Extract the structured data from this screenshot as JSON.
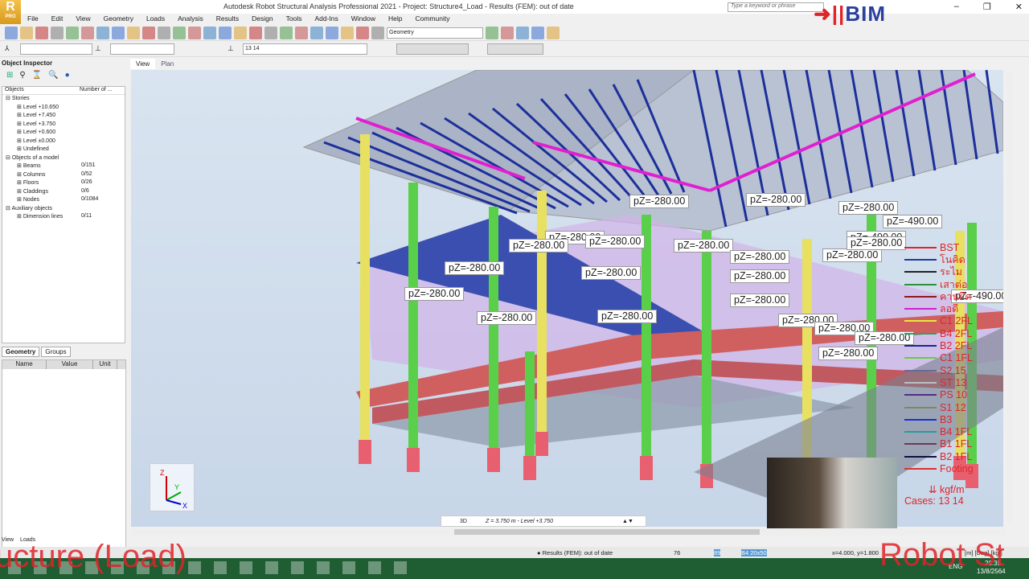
{
  "app": {
    "logo": "R",
    "logo_sub": "PRO",
    "title": "Autodesk Robot Structural Analysis Professional 2021 - Project: Structure4_Load - Results (FEM): out of date",
    "search_placeholder": "Type a keyword or phrase",
    "brand": "BIM"
  },
  "menu": [
    "File",
    "Edit",
    "View",
    "Geometry",
    "Loads",
    "Analysis",
    "Results",
    "Design",
    "Tools",
    "Add-Ins",
    "Window",
    "Help",
    "Community"
  ],
  "toolbar": {
    "layout_combo": "Geometry",
    "cases_combo": "13 14"
  },
  "inspector": {
    "title": "Object Inspector",
    "col_objects": "Objects",
    "col_number": "Number of ...",
    "rows": [
      {
        "label": "Stories",
        "count": ""
      },
      {
        "label": "Level +10.650",
        "count": ""
      },
      {
        "label": "Level +7.450",
        "count": ""
      },
      {
        "label": "Level +3.750",
        "count": ""
      },
      {
        "label": "Level +0.600",
        "count": ""
      },
      {
        "label": "Level ±0.000",
        "count": ""
      },
      {
        "label": "Undefined",
        "count": ""
      },
      {
        "label": "Objects of a model",
        "count": ""
      },
      {
        "label": "Beams",
        "count": "0/151"
      },
      {
        "label": "Columns",
        "count": "0/52"
      },
      {
        "label": "Floors",
        "count": "0/26"
      },
      {
        "label": "Claddings",
        "count": "0/6"
      },
      {
        "label": "Nodes",
        "count": "0/1084"
      },
      {
        "label": "Auxiliary objects",
        "count": ""
      },
      {
        "label": "Dimension lines",
        "count": "0/11"
      }
    ],
    "tabs": [
      "Geometry",
      "Groups"
    ],
    "prop_cols": [
      "Name",
      "Value",
      "Unit"
    ]
  },
  "view_tabs": [
    "View",
    "Plan"
  ],
  "loads": [
    "pZ=-280.00",
    "pZ=-280.00",
    "pZ=-280.00",
    "pZ=-280.00",
    "pZ=-280.00",
    "pZ=-280.00",
    "pZ=-280.00",
    "pZ=-280.00",
    "pZ=-280.00",
    "pZ=-280.00",
    "pZ=-490.00",
    "pZ=-490.00",
    "pZ=-280.00",
    "pZ=-280.00",
    "pZ=-280.00",
    "pZ=-280.00",
    "pZ=-280.00",
    "pZ=-280.00",
    "pZ=-280.00",
    "pZ=-280.00",
    "pZ=-280.00",
    "pZ=-280.00",
    "pZ=-490.00",
    "pZ=-280.00"
  ],
  "legend": {
    "items": [
      {
        "label": "BST",
        "color": "#e0242a"
      },
      {
        "label": "โนคิด",
        "color": "#1d3a9e"
      },
      {
        "label": "ระไม",
        "color": "#222222"
      },
      {
        "label": "เสาต่อ",
        "color": "#2f8f3f"
      },
      {
        "label": "คานยึด",
        "color": "#8b1d1d"
      },
      {
        "label": "ลอดี",
        "color": "#d020d0"
      },
      {
        "label": "C1 2FL",
        "color": "#e8e83a"
      },
      {
        "label": "B4 2FL",
        "color": "#2fa060"
      },
      {
        "label": "B2 2FL",
        "color": "#152a90"
      },
      {
        "label": "C1 1FL",
        "color": "#60d040"
      },
      {
        "label": "S2 15",
        "color": "#6a6a9a"
      },
      {
        "label": "ST 13",
        "color": "#b8c0c0"
      },
      {
        "label": "PS 10",
        "color": "#5a2a8a"
      },
      {
        "label": "S1 12",
        "color": "#7a8a60"
      },
      {
        "label": "B3",
        "color": "#1a30d0"
      },
      {
        "label": "B4 1FL",
        "color": "#2a9a9a"
      },
      {
        "label": "B1 1FL",
        "color": "#6a3a5a"
      },
      {
        "label": "B2 1FL",
        "color": "#101040"
      },
      {
        "label": "Footing",
        "color": "#e03030"
      }
    ],
    "unit": "kgf/m",
    "cases": "Cases: 13 14"
  },
  "view_status": {
    "mode": "3D",
    "level": "Z = 3.750 m - Level +3.750"
  },
  "status": {
    "results": "Results (FEM): out of date",
    "n1": "76",
    "n2": "89",
    "section": "B4 20x50",
    "coords": "x=4.000, y=1.800",
    "units": "[m] [Deg] [kgf]",
    "time": "20:35",
    "date": "13/8/2564",
    "lang": "ENG"
  },
  "bottom_tabs": [
    "View",
    "Loads"
  ],
  "overlay": {
    "left": "ucture (Load)",
    "right": "Robot St"
  }
}
